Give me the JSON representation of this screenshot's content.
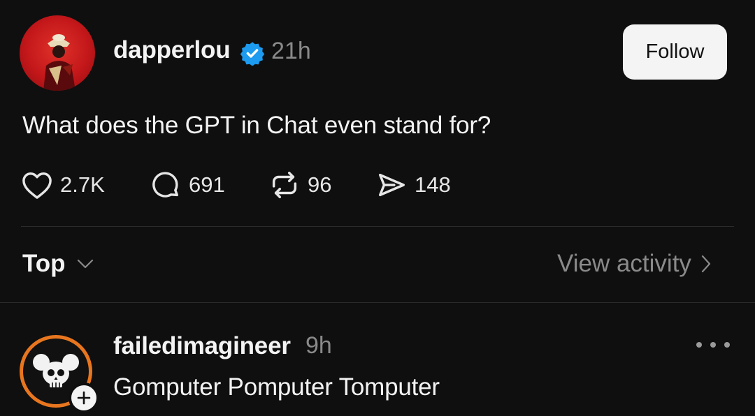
{
  "post": {
    "username": "dapperlou",
    "verified": true,
    "time": "21h",
    "follow_label": "Follow",
    "text": "What does the GPT in Chat even stand for?",
    "actions": {
      "likes": "2.7K",
      "replies": "691",
      "reposts": "96",
      "shares": "148"
    }
  },
  "sort": {
    "label": "Top"
  },
  "activity": {
    "label": "View activity"
  },
  "reply": {
    "username": "failedimagineer",
    "time": "9h",
    "text": "Gomputer Pomputer Tomputer"
  },
  "colors": {
    "background": "#0f0f0f",
    "text_primary": "#f3f3f3",
    "text_secondary": "#8a8a8a",
    "verified_blue": "#1d9bf0",
    "follow_bg": "#f4f4f4",
    "avatar_ring": "#e8761f"
  },
  "icons": {
    "like": "heart-icon",
    "reply": "comment-icon",
    "repost": "repost-icon",
    "share": "send-icon",
    "sort": "chevron-down-icon",
    "activity": "chevron-right-icon",
    "more": "more-horizontal-icon",
    "badge": "plus-icon"
  }
}
